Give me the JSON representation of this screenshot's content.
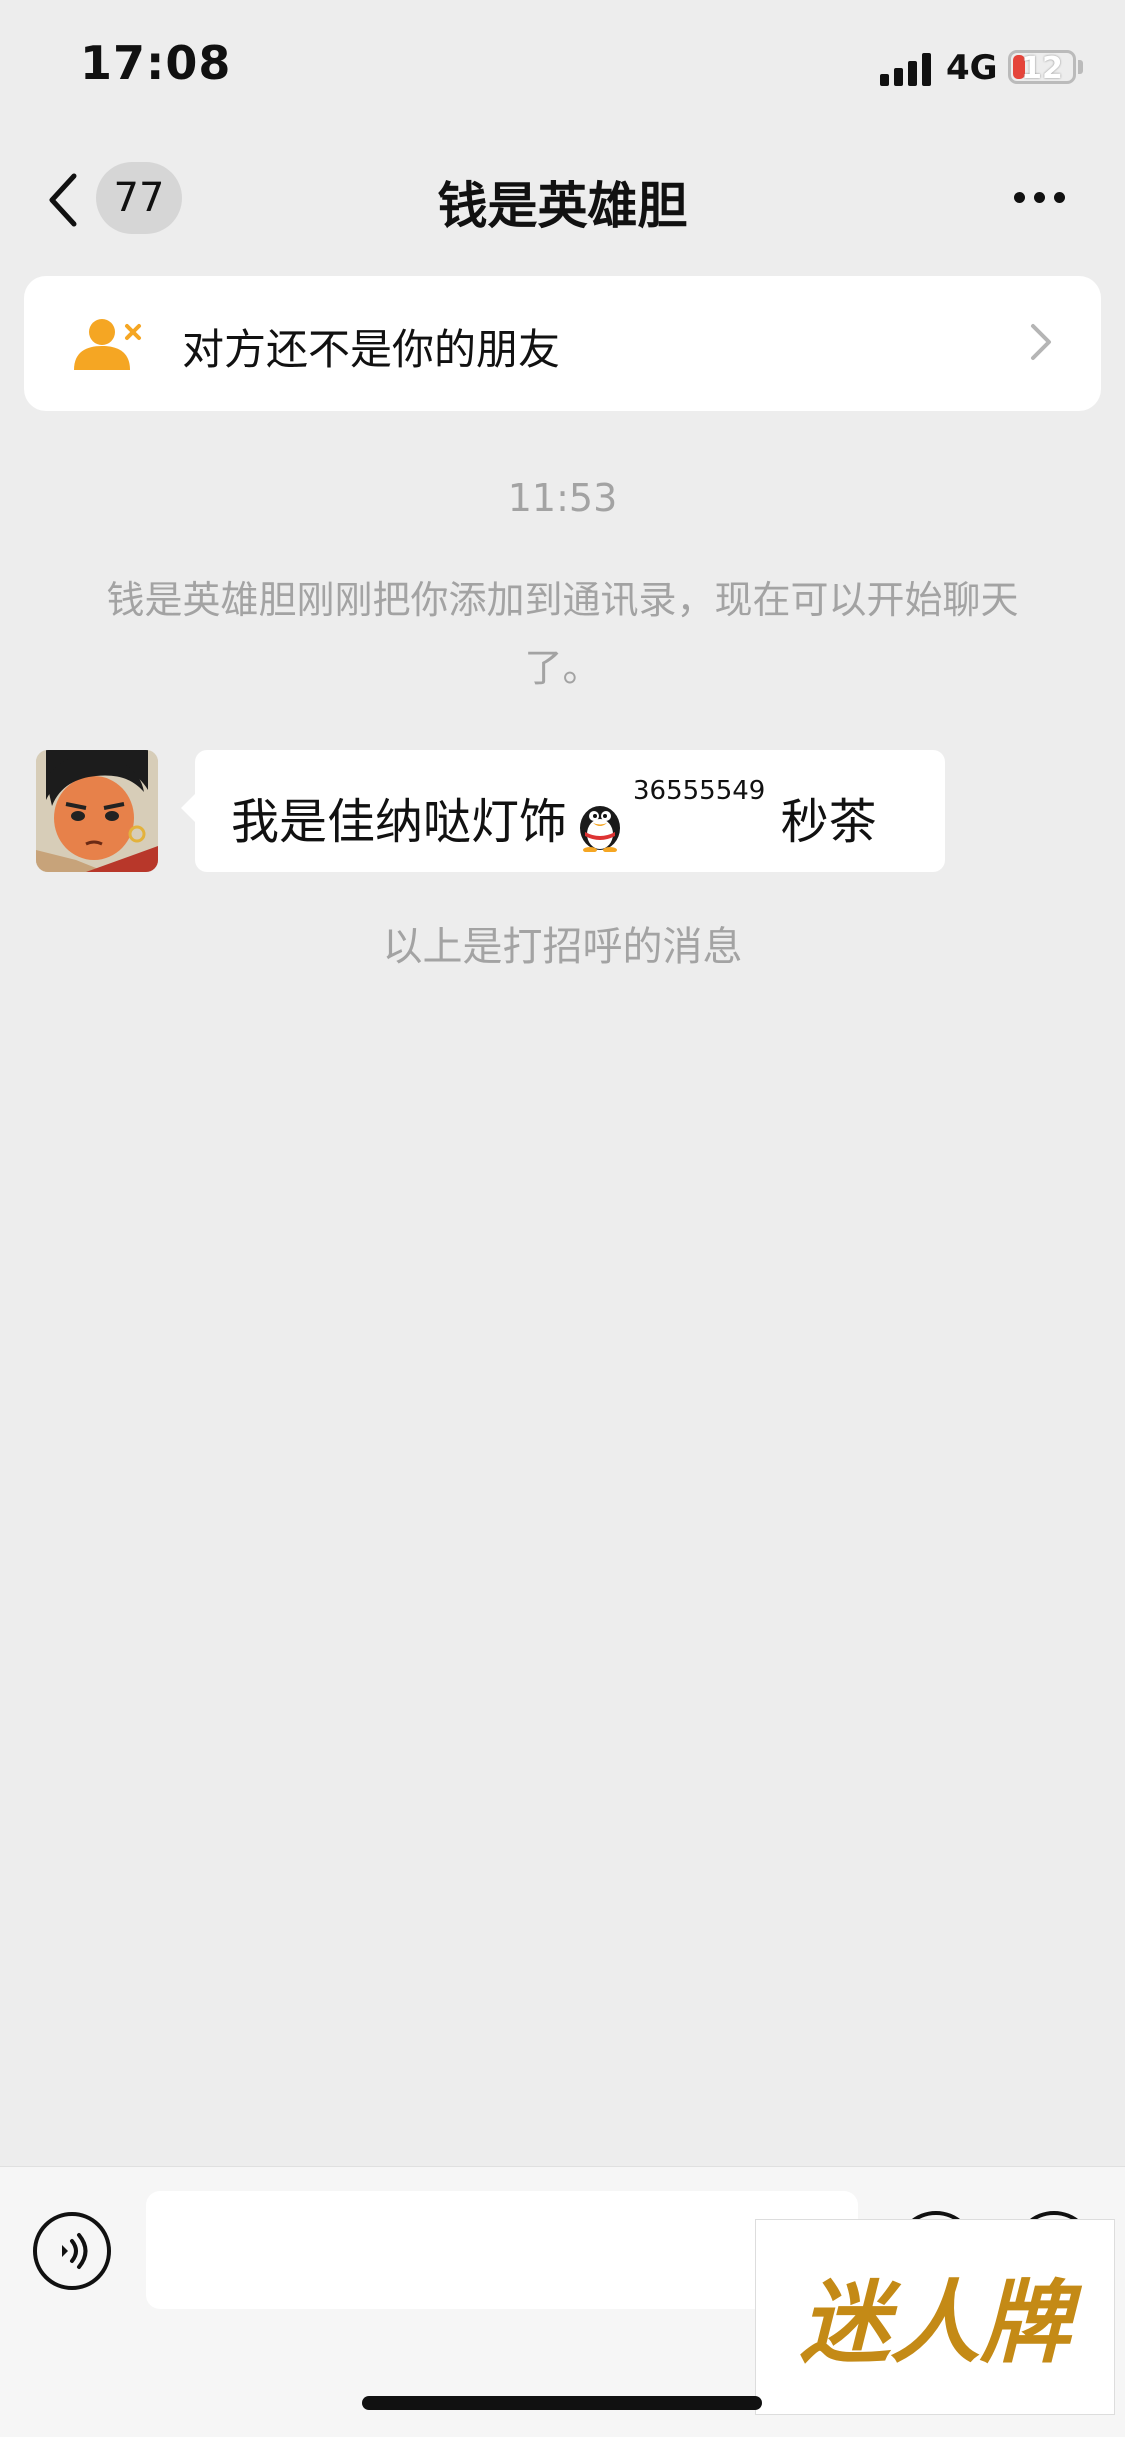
{
  "status_bar": {
    "time": "17:08",
    "network": "4G",
    "battery": "12"
  },
  "nav": {
    "unread_count": "77",
    "title": "钱是英雄胆"
  },
  "banner": {
    "text": "对方还不是你的朋友"
  },
  "chat": {
    "timestamp": "11:53",
    "system_message": "钱是英雄胆刚刚把你添加到通讯录，现在可以开始聊天了。",
    "message": {
      "text_before": "我是佳纳哒灯饰",
      "qq_number": "36555549",
      "text_after": "秒茶"
    },
    "greeting_note": "以上是打招呼的消息"
  },
  "watermark": {
    "text": "迷人牌"
  },
  "colors": {
    "background": "#ededed",
    "banner_icon": "#f5a623",
    "battery_low": "#e5443a",
    "system_text": "#a3a3a3"
  }
}
